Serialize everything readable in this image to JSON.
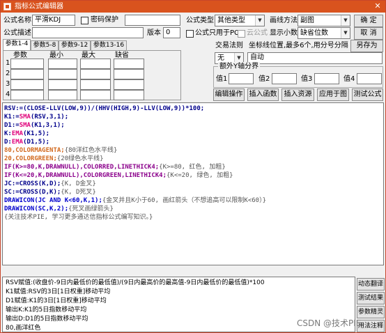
{
  "window": {
    "title": "指标公式编辑器",
    "close_label": "✕"
  },
  "form": {
    "name_label": "公式名称",
    "name_value": "平滑KDJ",
    "password_label": "密码保护",
    "desc_label": "公式描述",
    "desc_value": "",
    "version_label": "版本",
    "version_value": "0",
    "type_label": "公式类型",
    "type_value": "其他类型",
    "draw_label": "画线方法",
    "draw_value": "副图",
    "pc_only_label": "公式只用于PC",
    "cloud_label": "云公式",
    "decimals_label": "显示小数",
    "decimals_value": "缺省位数"
  },
  "buttons": {
    "ok": "确 定",
    "cancel": "取 消",
    "save_as": "另存为"
  },
  "tabs": [
    "参数1-4",
    "参数5-8",
    "参数9-12",
    "参数13-16"
  ],
  "params": {
    "headers": [
      "参数",
      "最小",
      "最大",
      "缺省"
    ],
    "rows": [
      "1",
      "2",
      "3",
      "4"
    ]
  },
  "trade": {
    "label": "交易法则",
    "value": "无"
  },
  "coords": {
    "label": "坐标线位置,最多6个,用分号分隔",
    "value": "自动"
  },
  "yaxis": {
    "label": "额外Y轴分界",
    "values": [
      "值1",
      "值2",
      "值3",
      "值4"
    ]
  },
  "actions": [
    "编辑操作",
    "插入函数",
    "插入资源",
    "应用于图",
    "测试公式"
  ],
  "code_lines": [
    [
      {
        "t": "RSV:=(CLOSE-LLV(LOW,9))/(HHV(HIGH,9)-LLV(LOW,9))*100;",
        "c": "#00008b",
        "b": 1
      }
    ],
    [
      {
        "t": "K1:=",
        "c": "#00008b",
        "b": 1
      },
      {
        "t": "SMA",
        "c": "#e0007a",
        "b": 1
      },
      {
        "t": "(RSV,3,1);",
        "c": "#00008b",
        "b": 1
      }
    ],
    [
      {
        "t": "D1:=",
        "c": "#00008b",
        "b": 1
      },
      {
        "t": "SMA",
        "c": "#e0007a",
        "b": 1
      },
      {
        "t": "(K1,3,1);",
        "c": "#00008b",
        "b": 1
      }
    ],
    [
      {
        "t": "K:",
        "c": "#00008b",
        "b": 1
      },
      {
        "t": "EMA",
        "c": "#e0007a",
        "b": 1
      },
      {
        "t": "(K1,5);",
        "c": "#00008b",
        "b": 1
      }
    ],
    [
      {
        "t": "D:",
        "c": "#00008b",
        "b": 1
      },
      {
        "t": "EMA",
        "c": "#e0007a",
        "b": 1
      },
      {
        "t": "(D1,5);",
        "c": "#00008b",
        "b": 1
      }
    ],
    [
      {
        "t": "80,COLORMAGENTA;",
        "c": "#d2691e",
        "b": 1
      },
      {
        "t": "{80洋红色水平线}",
        "c": "#555555",
        "b": 0
      }
    ],
    [
      {
        "t": "20,COLORGREEN;",
        "c": "#d2691e",
        "b": 1
      },
      {
        "t": "{20绿色水平线}",
        "c": "#555555",
        "b": 0
      }
    ],
    [
      {
        "t": "IF(K>=80,K,DRAWNULL),COLORRED,LINETHICK4;",
        "c": "#8b008b",
        "b": 1
      },
      {
        "t": "{K>=80, 红色, 加粗}",
        "c": "#555555",
        "b": 0
      }
    ],
    [
      {
        "t": "IF(K<=20,K,DRAWNULL),COLORGREEN,LINETHICK4;",
        "c": "#8b008b",
        "b": 1
      },
      {
        "t": "{K<=20, 绿色, 加粗}",
        "c": "#555555",
        "b": 0
      }
    ],
    [
      {
        "t": "JC:=CROSS(K,D);",
        "c": "#00008b",
        "b": 1
      },
      {
        "t": "{K, D金叉}",
        "c": "#555555",
        "b": 0
      }
    ],
    [
      {
        "t": "SC:=CROSS(D,K);",
        "c": "#00008b",
        "b": 1
      },
      {
        "t": "{K, D死叉}",
        "c": "#555555",
        "b": 0
      }
    ],
    [
      {
        "t": "DRAWICON(JC AND K<60,K,1);",
        "c": "#0000cd",
        "b": 1
      },
      {
        "t": "{金叉并且K小于60, 画红箭头（不想追高可以限制K<60）}",
        "c": "#555555",
        "b": 0
      }
    ],
    [
      {
        "t": "DRAWICON(SC,K,2);",
        "c": "#0000cd",
        "b": 1
      },
      {
        "t": "{死叉画绿箭头}",
        "c": "#555555",
        "b": 0
      }
    ],
    [
      {
        "t": "{关注技术PIE, 学习更多通达信指标公式编写知识。}",
        "c": "#555555",
        "b": 0
      }
    ]
  ],
  "explain_lines": [
    "RSV赋值:(收盘价-9日内最低价的最低值)/(9日内最高价的最高值-9日内最低价的最低值)*100",
    "K1赋值:RSV的3日[1日权重]移动平均",
    "D1赋值:K1的3日[1日权重]移动平均",
    "输出K:K1的5日指数移动平均",
    "输出D:D1的5日指数移动平均",
    "80,画洋红色"
  ],
  "side_buttons": [
    "动态翻译",
    "测试结果",
    "参数精灵",
    "用法注释"
  ],
  "watermark": "CSDN @技术PIE"
}
